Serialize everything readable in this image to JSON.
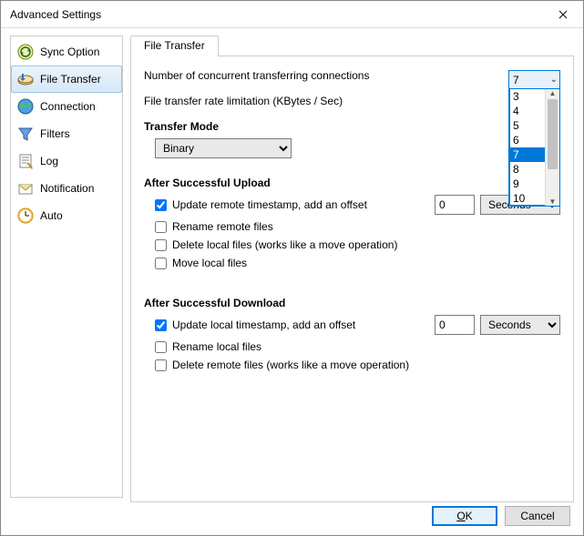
{
  "window": {
    "title": "Advanced Settings"
  },
  "sidebar": {
    "items": [
      {
        "label": "Sync Option"
      },
      {
        "label": "File Transfer"
      },
      {
        "label": "Connection"
      },
      {
        "label": "Filters"
      },
      {
        "label": "Log"
      },
      {
        "label": "Notification"
      },
      {
        "label": "Auto"
      }
    ],
    "selected_index": 1
  },
  "tab": {
    "label": "File Transfer"
  },
  "fields": {
    "concurrent_label": "Number of concurrent transferring connections",
    "concurrent_value": "7",
    "concurrent_options": [
      "3",
      "4",
      "5",
      "6",
      "7",
      "8",
      "9",
      "10"
    ],
    "rate_label": "File transfer rate limitation (KBytes / Sec)",
    "mode_head": "Transfer Mode",
    "mode_value": "Binary"
  },
  "upload": {
    "head": "After Successful Upload",
    "cb1": "Update remote timestamp, add an offset",
    "cb1_checked": true,
    "offset": "0",
    "unit": "Seconds",
    "cb2": "Rename remote files",
    "cb3": "Delete local files (works like a move operation)",
    "cb4": "Move local files"
  },
  "download": {
    "head": "After Successful Download",
    "cb1": "Update local timestamp, add an offset",
    "cb1_checked": true,
    "offset": "0",
    "unit": "Seconds",
    "cb2": "Rename local files",
    "cb3": "Delete remote files (works like a move operation)"
  },
  "footer": {
    "ok_u": "O",
    "ok_rest": "K",
    "cancel": "Cancel"
  }
}
